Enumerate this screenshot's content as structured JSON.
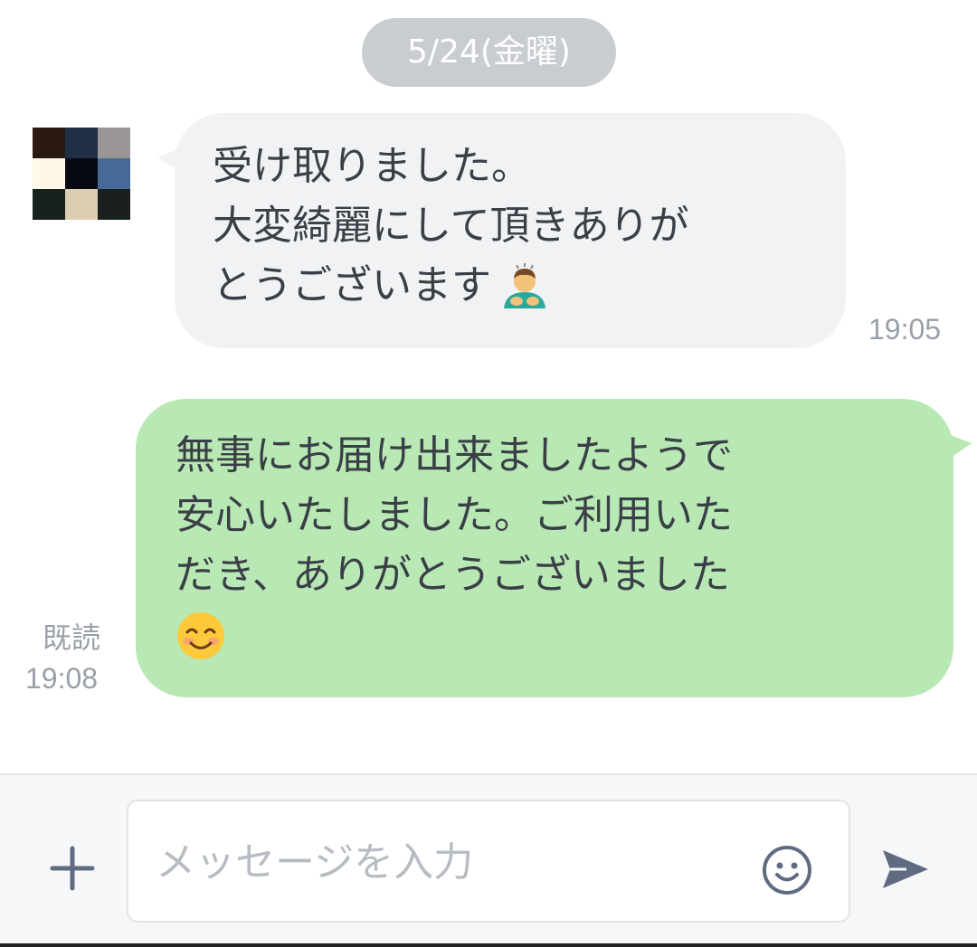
{
  "chat": {
    "date_label": "5/24(金曜)",
    "avatar_colors": [
      "#2a1a12",
      "#1f2f47",
      "#9a9696",
      "#fff8e8",
      "#060812",
      "#466a95",
      "#18221c",
      "#dccfb1",
      "#1a2020"
    ],
    "incoming": {
      "lines": [
        "受け取りました。",
        "大変綺麗にして頂きありが",
        "とうございます"
      ],
      "emoji": "man-bowing-icon",
      "time": "19:05"
    },
    "outgoing": {
      "lines": [
        "無事にお届け出来ましたようで",
        "安心いたしました。ご利用いた",
        "だき、ありがとうございました"
      ],
      "emoji": "smiling-face-icon",
      "read_label": "既読",
      "time": "19:08"
    }
  },
  "input_bar": {
    "placeholder": "メッセージを入力",
    "icons": [
      "plus-icon",
      "smiley-icon",
      "send-icon"
    ]
  },
  "colors": {
    "incoming_bubble": "#f1f2f4",
    "outgoing_bubble": "#b8e8b3",
    "date_pill": "#c9ccd1",
    "icon_gray": "#5f6b80"
  }
}
